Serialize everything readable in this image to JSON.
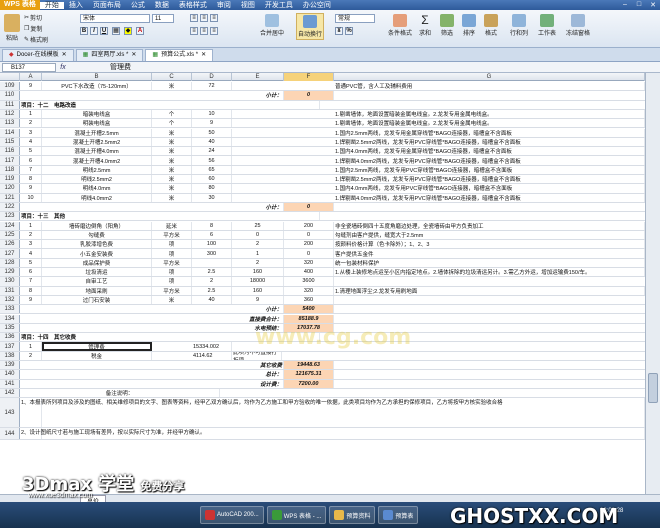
{
  "titlebar": {
    "app": "WPS 表格",
    "menus": [
      "开始",
      "插入",
      "页面布局",
      "公式",
      "数据",
      "表格样式",
      "审阅",
      "视图",
      "开发工具",
      "办公空间"
    ],
    "active": "开始"
  },
  "ribbon": {
    "paste": "粘贴",
    "cut": "剪切",
    "copy": "复制",
    "format_painter": "格式刷",
    "font": "宋体",
    "size": "11",
    "merge": "合并居中",
    "autowrap": "自动换行",
    "general": "常规",
    "cond": "条件格式",
    "sum": "求和",
    "filter": "筛选",
    "sort": "排序",
    "format": "格式",
    "rowcol": "行和列",
    "worksheet": "工作表",
    "freeze": "冻结窗格"
  },
  "tabs": [
    {
      "label": "Docer-在线模板"
    },
    {
      "label": "四室两厅.xls *"
    },
    {
      "label": "预算公式.xls *"
    }
  ],
  "formula": {
    "namebox": "B137",
    "content": "管理费"
  },
  "columns": [
    "A",
    "B",
    "C",
    "D",
    "E",
    "F",
    "G"
  ],
  "rows": [
    {
      "n": "109",
      "a": "9",
      "b": "PVC下水改造（75-120mm）",
      "c": "米",
      "d": "72",
      "g": "普通PVC管，含人工及辅料费用"
    },
    {
      "n": "110",
      "e": "小计：",
      "f": "0"
    },
    {
      "n": "111",
      "a": "项目：十二　电路改造"
    },
    {
      "n": "112",
      "a": "1",
      "b": "暗装电线盒",
      "c": "个",
      "d": "10",
      "g": "1.剔凿墙体，地面设置暗装金属电线盒。2.龙发专用金属电线盒。"
    },
    {
      "n": "113",
      "a": "2",
      "b": "明装电线盒",
      "c": "个",
      "d": "9",
      "g": "1.剔凿墙体，地面设置暗装金属电线盒。2.龙发专用金属电线盒。"
    },
    {
      "n": "114",
      "a": "3",
      "b": "混凝土开槽2.5mm",
      "c": "米",
      "d": "50",
      "g": "1.国内2.5mm两线，龙发专用金属穿线管*BAGO连接器，暗槽盒不含面板"
    },
    {
      "n": "115",
      "a": "4",
      "b": "混凝土开槽2.5mm2",
      "c": "米",
      "d": "40",
      "g": "1.焊剔凿2.5mm2两线，龙发专用PVC穿线管*BAGO连接器，暗槽盒不含面板"
    },
    {
      "n": "116",
      "a": "5",
      "b": "混凝土开槽4.0mm",
      "c": "米",
      "d": "24",
      "g": "1.国内4.0mm两线，龙发专用金属穿线管*BAGO连接器，暗槽盒不含面板"
    },
    {
      "n": "117",
      "a": "6",
      "b": "混凝土开槽4.0mm2",
      "c": "米",
      "d": "56",
      "g": "1.焊剔凿4.0mm2两线，龙发专用PVC穿线管*BAGO连接器，暗槽盒不含面板"
    },
    {
      "n": "118",
      "a": "7",
      "b": "明线2.5mm",
      "c": "米",
      "d": "65",
      "g": "1.国内2.5mm两线，龙发专用PVC穿线管*BAGO连接器，暗槽盒不含面板"
    },
    {
      "n": "119",
      "a": "8",
      "b": "明线2.5mm2",
      "c": "米",
      "d": "60",
      "g": "1.焊剔凿2.5mm2两线，龙发专用PVC穿线管*BAGO连接器，暗槽盒不含面板"
    },
    {
      "n": "120",
      "a": "9",
      "b": "明线4.0mm",
      "c": "米",
      "d": "80",
      "g": "1.国内4.0mm两线，龙发专用PVC穿线管*BAGO连接器，暗槽盒不含面板"
    },
    {
      "n": "121",
      "a": "10",
      "b": "明线4.0mm2",
      "c": "米",
      "d": "30",
      "g": "1.焊剔凿4.0mm2两线，龙发专用PVC穿线管*BAGO连接器，暗槽盒不含面板"
    },
    {
      "n": "122",
      "e": "小计：",
      "f": "0"
    },
    {
      "n": "123",
      "a": "项目：十三　其他"
    },
    {
      "n": "124",
      "a": "1",
      "b": "墙砖磨边倒角（阳角）",
      "c": "延米",
      "d": "8",
      "e": "25",
      "f": "200",
      "g": "非全瓷墙砖倒四十五度角磨边处理，全瓷墙砖由甲方负责加工"
    },
    {
      "n": "125",
      "a": "2",
      "b": "勾缝费",
      "c": "平方米",
      "d": "6",
      "e": "0",
      "f": "0",
      "g": "勾缝剂由客户提供，缝宽大于2.5mm"
    },
    {
      "n": "126",
      "a": "3",
      "b": "乳胶漆增色费",
      "c": "项",
      "d": "100",
      "e": "2",
      "f": "200",
      "g": "按颜料价格计算（色卡除外）；1、2、3"
    },
    {
      "n": "127",
      "a": "4",
      "b": "小五金安装费",
      "c": "项",
      "d": "300",
      "e": "1",
      "f": "0",
      "g": "客户提供五金件"
    },
    {
      "n": "128",
      "a": "5",
      "b": "成品保护费",
      "c": "平方米",
      "d": "",
      "e": "2",
      "f": "320",
      "g": "统一包装材料保护"
    },
    {
      "n": "129",
      "a": "6",
      "b": "垃圾清运",
      "c": "项",
      "d": "2.5",
      "e": "160",
      "f": "400",
      "g": "1.从楼上装修地点运至小区内指定地点。2.墙体拆除的垃圾清运另计。3.需乙方外运，增加运输费150/车。"
    },
    {
      "n": "130",
      "a": "7",
      "b": "自审工艺",
      "c": "项",
      "d": "2",
      "e": "18000",
      "f": "3600"
    },
    {
      "n": "131",
      "a": "8",
      "b": "地面采刷",
      "c": "平方米",
      "d": "2.5",
      "e": "160",
      "f": "320",
      "g": "1.清理地面浮尘;2.龙发专用刷地面"
    },
    {
      "n": "132",
      "a": "9",
      "b": "过门石安装",
      "c": "米",
      "d": "40",
      "e": "9",
      "f": "360"
    },
    {
      "n": "133",
      "e": "小计：",
      "f": "5400"
    },
    {
      "n": "134",
      "e": "直接费合计：",
      "f": "85188.9"
    },
    {
      "n": "135",
      "e": "水电预结：",
      "f": "17037.78"
    },
    {
      "n": "136",
      "a": "项目：十四　其它收费"
    },
    {
      "n": "137",
      "a": "1",
      "b": "管理费",
      "d": "15334.002"
    },
    {
      "n": "138",
      "a": "2",
      "b": "税金",
      "d": "4114.62",
      "e": "此项为不可直接打折项"
    },
    {
      "n": "139",
      "e": "其它收费",
      "f": "19448.63"
    },
    {
      "n": "140",
      "e": "总计：",
      "f": "121675.31"
    },
    {
      "n": "141",
      "e": "设计费：",
      "f": "7200.00"
    },
    {
      "n": "142",
      "a": "备注说明："
    },
    {
      "n": "143",
      "a": "",
      "g": "1、本报表所列项目及涉及的图纸、相关维修项目的文字、图表等资料，经甲乙双方确认后，均作为乙方施工和甲方验收的唯一依据，此类项目均作为乙方承担的保修项目，乙方将按甲方核实验收合格"
    },
    {
      "n": "144",
      "a": "",
      "g": "2、设计图纸尺寸若与施工现场有差异，按以实际尺寸为准，并经甲方确认。"
    }
  ],
  "sheet_tab": "总价",
  "taskbar": [
    "AutoCAD 200...",
    "WPS 表格 - ...",
    "预算资料",
    "预算表"
  ],
  "clock": "00:03:28",
  "watermarks": {
    "a": "3Dmax 学堂",
    "a_sub": "免费分享",
    "b": "www.xue3dmax.com",
    "c": "www.cg.com",
    "d": "GHOSTXX.COM"
  },
  "colors": {
    "accent": "#e8a010",
    "orange_fill": "#fcd5b4"
  }
}
